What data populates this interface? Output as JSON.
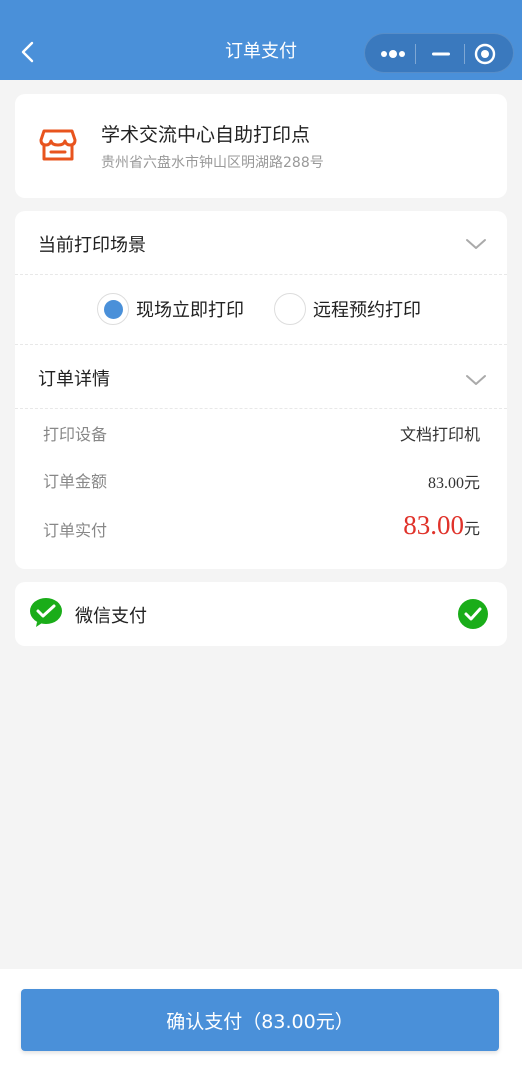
{
  "nav": {
    "title": "订单支付",
    "back_icon": "chevron-left-icon",
    "bg_color": "#4a90d9"
  },
  "store": {
    "name": "学术交流中心自助打印点",
    "address": "贵州省六盘水市钟山区明湖路288号",
    "icon": "store-icon",
    "icon_color": "#e8541e"
  },
  "scene": {
    "label": "当前打印场景",
    "options": [
      {
        "label": "现场立即打印",
        "checked": true
      },
      {
        "label": "远程预约打印",
        "checked": false
      }
    ]
  },
  "details": {
    "label": "订单详情",
    "device_label": "打印设备",
    "device_value": "文档打印机",
    "amount_label": "订单金额",
    "amount_value": "83.00元",
    "paid_label": "订单实付",
    "paid_number": "83.00",
    "paid_unit": "元",
    "paid_color": "#e0322a"
  },
  "payment": {
    "method": "微信支付",
    "icon": "wechat-pay-icon",
    "selected": true,
    "check_color": "#1aad19"
  },
  "confirm": {
    "label": "确认支付（83.00元）"
  }
}
